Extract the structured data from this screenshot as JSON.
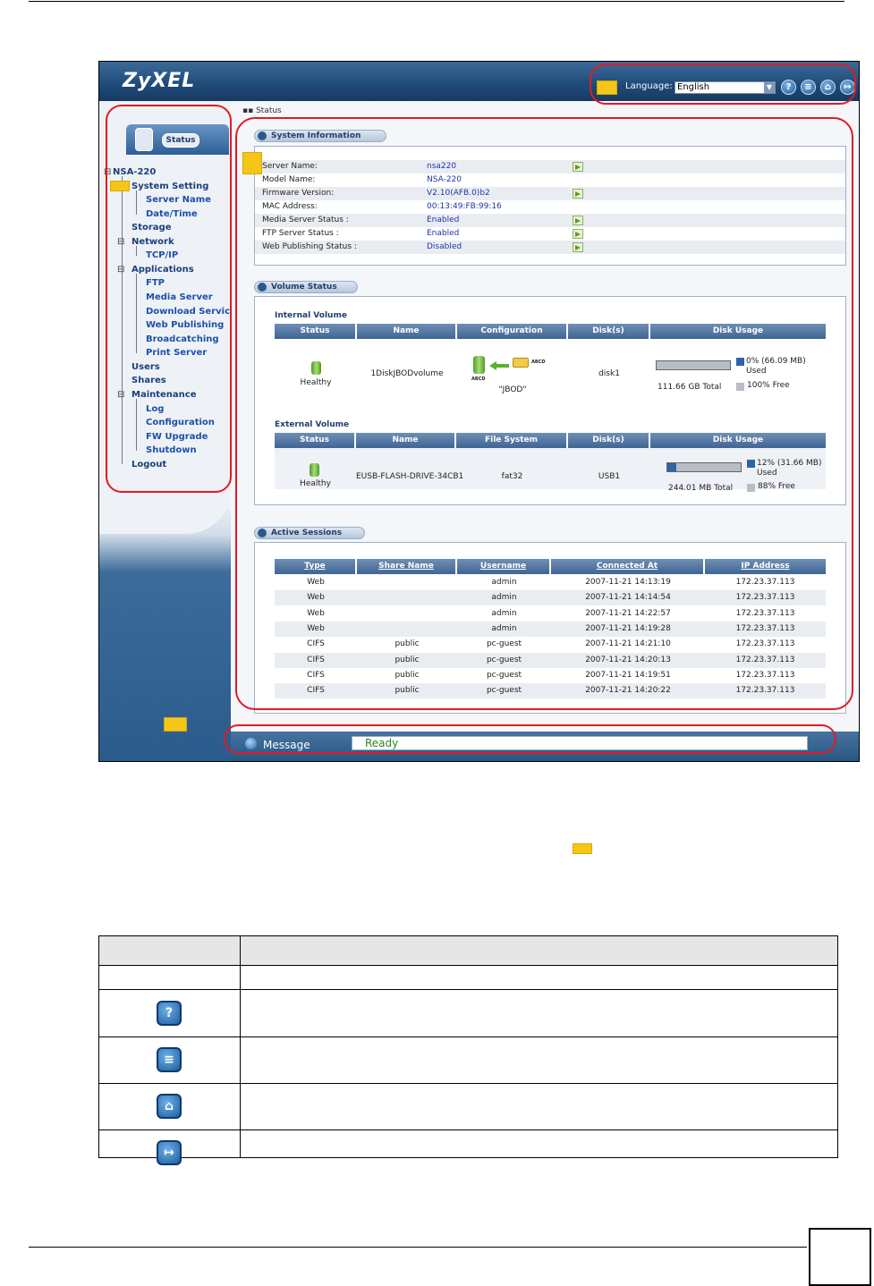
{
  "header": {
    "logo": "ZyXEL",
    "language_label": "Language:",
    "language_value": "English",
    "icons": [
      "help-icon",
      "about-icon",
      "home-icon",
      "logout-icon"
    ]
  },
  "breadcrumb": "Status",
  "sidebar": {
    "status_tab": "Status",
    "root": "NSA-220",
    "items": [
      {
        "label": "System Setting"
      },
      {
        "label": "Server Name"
      },
      {
        "label": "Date/Time"
      },
      {
        "label": "Storage"
      },
      {
        "label": "Network"
      },
      {
        "label": "TCP/IP"
      },
      {
        "label": "Applications"
      },
      {
        "label": "FTP"
      },
      {
        "label": "Media Server"
      },
      {
        "label": "Download Service"
      },
      {
        "label": "Web Publishing"
      },
      {
        "label": "Broadcatching"
      },
      {
        "label": "Print Server"
      },
      {
        "label": "Users"
      },
      {
        "label": "Shares"
      },
      {
        "label": "Maintenance"
      },
      {
        "label": "Log"
      },
      {
        "label": "Configuration"
      },
      {
        "label": "FW Upgrade"
      },
      {
        "label": "Shutdown"
      },
      {
        "label": "Logout"
      }
    ]
  },
  "system_info": {
    "title": "System Information",
    "rows": [
      {
        "key": "Server Name:",
        "value": "nsa220",
        "has_link": true
      },
      {
        "key": "Model Name:",
        "value": "NSA-220",
        "has_link": false
      },
      {
        "key": "Firmware Version:",
        "value": "V2.10(AFB.0)b2",
        "has_link": true
      },
      {
        "key": "MAC Address:",
        "value": "00:13:49:FB:99:16",
        "has_link": false
      },
      {
        "key": "Media Server Status :",
        "value": "Enabled",
        "has_link": true
      },
      {
        "key": "FTP Server Status :",
        "value": "Enabled",
        "has_link": true
      },
      {
        "key": "Web Publishing Status :",
        "value": "Disabled",
        "has_link": true
      }
    ]
  },
  "volume_status": {
    "title": "Volume Status",
    "internal": {
      "label": "Internal Volume",
      "headers": [
        "Status",
        "Name",
        "Configuration",
        "Disk(s)",
        "Disk Usage"
      ],
      "status": "Healthy",
      "name": "1DiskJBODvolume",
      "config": "\"JBOD\"",
      "config_tags": [
        "ABCD",
        "ABCD"
      ],
      "disks": "disk1",
      "usage_fraction": 0.0,
      "used_text": "0% (66.09 MB) Used",
      "total_text": "111.66 GB Total",
      "free_text": "100% Free"
    },
    "external": {
      "label": "External Volume",
      "headers": [
        "Status",
        "Name",
        "File System",
        "Disk(s)",
        "Disk Usage"
      ],
      "status": "Healthy",
      "name": "EUSB-FLASH-DRIVE-34CB1",
      "fs": "fat32",
      "disks": "USB1",
      "usage_fraction": 0.12,
      "used_text": "12% (31.66 MB) Used",
      "total_text": "244.01 MB Total",
      "free_text": "88% Free"
    }
  },
  "sessions": {
    "title": "Active Sessions",
    "headers": [
      "Type",
      "Share Name",
      "Username",
      "Connected At",
      "IP Address"
    ],
    "rows": [
      [
        "Web",
        "",
        "admin",
        "2007-11-21 14:13:19",
        "172.23.37.113"
      ],
      [
        "Web",
        "",
        "admin",
        "2007-11-21 14:14:54",
        "172.23.37.113"
      ],
      [
        "Web",
        "",
        "admin",
        "2007-11-21 14:22:57",
        "172.23.37.113"
      ],
      [
        "Web",
        "",
        "admin",
        "2007-11-21 14:19:28",
        "172.23.37.113"
      ],
      [
        "CIFS",
        "public",
        "pc-guest",
        "2007-11-21 14:21:10",
        "172.23.37.113"
      ],
      [
        "CIFS",
        "public",
        "pc-guest",
        "2007-11-21 14:20:13",
        "172.23.37.113"
      ],
      [
        "CIFS",
        "public",
        "pc-guest",
        "2007-11-21 14:19:51",
        "172.23.37.113"
      ],
      [
        "CIFS",
        "public",
        "pc-guest",
        "2007-11-21 14:20:22",
        "172.23.37.113"
      ]
    ]
  },
  "message": {
    "label": "Message",
    "value": "Ready"
  },
  "lower_table": {
    "icons": [
      "help-icon",
      "about-icon",
      "home-icon",
      "logout-icon"
    ]
  },
  "colors": {
    "callout_red": "#e01b24",
    "callout_yellow": "#f5c518",
    "ready_green": "#2b8a1b"
  }
}
